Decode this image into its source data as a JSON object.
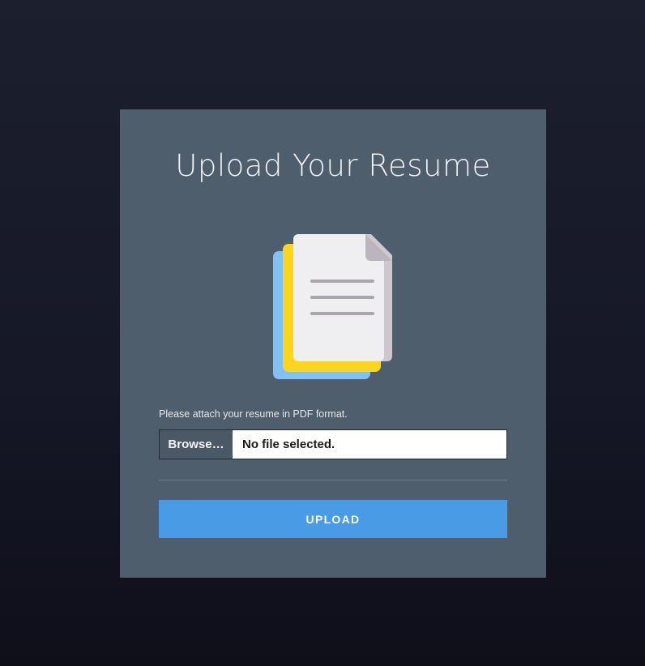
{
  "page": {
    "title": "Upload Your Resume",
    "hint": "Please attach your resume in PDF format.",
    "file_input": {
      "browse_label": "Browse…",
      "status": "No file selected."
    },
    "upload_button_label": "UPLOAD"
  },
  "icons": {
    "illustration": "document-stack-icon"
  },
  "colors": {
    "card_background": "#4f5e6c",
    "upload_button": "#4a9be6",
    "browse_button": "#4b5966",
    "doc_blue": "#7fc2f5",
    "doc_yellow": "#ffd51c",
    "doc_paper": "#efeef1",
    "doc_fold": "#bbb6bd",
    "doc_lines": "#aaa6ae"
  }
}
